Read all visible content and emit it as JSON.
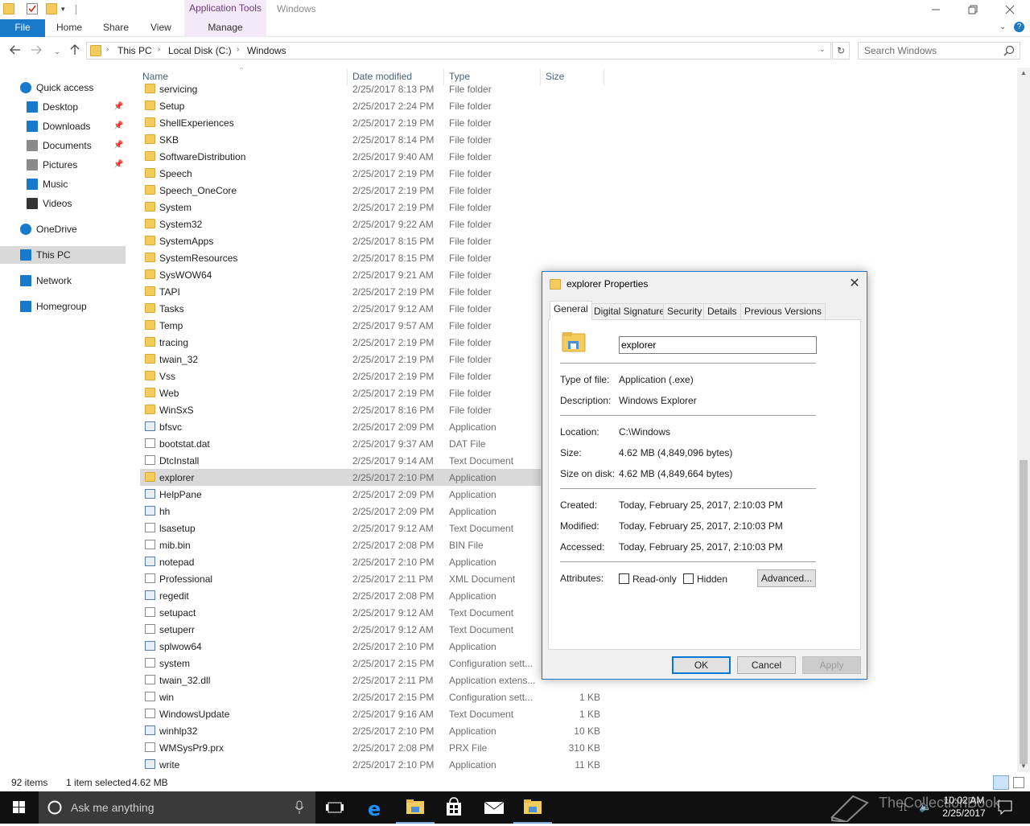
{
  "window": {
    "title": "Windows",
    "app_tools_label": "Application Tools",
    "manage_label": "Manage"
  },
  "ribbon": {
    "tabs": [
      "File",
      "Home",
      "Share",
      "View"
    ]
  },
  "address": {
    "crumbs": [
      "This PC",
      "Local Disk (C:)",
      "Windows"
    ],
    "search_placeholder": "Search Windows"
  },
  "nav": {
    "items": [
      {
        "label": "Quick access",
        "icon": "star-icon",
        "pinned": false
      },
      {
        "label": "Desktop",
        "icon": "desktop-icon",
        "pinned": true
      },
      {
        "label": "Downloads",
        "icon": "download-arrow-icon",
        "pinned": true
      },
      {
        "label": "Documents",
        "icon": "documents-icon",
        "pinned": true
      },
      {
        "label": "Pictures",
        "icon": "pictures-icon",
        "pinned": true
      },
      {
        "label": "Music",
        "icon": "music-note-icon",
        "pinned": false
      },
      {
        "label": "Videos",
        "icon": "film-icon",
        "pinned": false
      },
      {
        "label": "OneDrive",
        "icon": "cloud-icon",
        "pinned": false
      },
      {
        "label": "This PC",
        "icon": "computer-icon",
        "pinned": false,
        "selected": true
      },
      {
        "label": "Network",
        "icon": "network-icon",
        "pinned": false
      },
      {
        "label": "Homegroup",
        "icon": "homegroup-icon",
        "pinned": false
      }
    ]
  },
  "columns": {
    "name": "Name",
    "date": "Date modified",
    "type": "Type",
    "size": "Size"
  },
  "files": [
    {
      "name": "servicing",
      "date": "2/25/2017 8:13 PM",
      "type": "File folder",
      "size": "",
      "kind": "folder"
    },
    {
      "name": "Setup",
      "date": "2/25/2017 2:24 PM",
      "type": "File folder",
      "size": "",
      "kind": "folder"
    },
    {
      "name": "ShellExperiences",
      "date": "2/25/2017 2:19 PM",
      "type": "File folder",
      "size": "",
      "kind": "folder"
    },
    {
      "name": "SKB",
      "date": "2/25/2017 8:14 PM",
      "type": "File folder",
      "size": "",
      "kind": "folder"
    },
    {
      "name": "SoftwareDistribution",
      "date": "2/25/2017 9:40 AM",
      "type": "File folder",
      "size": "",
      "kind": "folder"
    },
    {
      "name": "Speech",
      "date": "2/25/2017 2:19 PM",
      "type": "File folder",
      "size": "",
      "kind": "folder"
    },
    {
      "name": "Speech_OneCore",
      "date": "2/25/2017 2:19 PM",
      "type": "File folder",
      "size": "",
      "kind": "folder"
    },
    {
      "name": "System",
      "date": "2/25/2017 2:19 PM",
      "type": "File folder",
      "size": "",
      "kind": "folder"
    },
    {
      "name": "System32",
      "date": "2/25/2017 9:22 AM",
      "type": "File folder",
      "size": "",
      "kind": "folder"
    },
    {
      "name": "SystemApps",
      "date": "2/25/2017 8:15 PM",
      "type": "File folder",
      "size": "",
      "kind": "folder"
    },
    {
      "name": "SystemResources",
      "date": "2/25/2017 8:15 PM",
      "type": "File folder",
      "size": "",
      "kind": "folder"
    },
    {
      "name": "SysWOW64",
      "date": "2/25/2017 9:21 AM",
      "type": "File folder",
      "size": "",
      "kind": "folder"
    },
    {
      "name": "TAPI",
      "date": "2/25/2017 2:19 PM",
      "type": "File folder",
      "size": "",
      "kind": "folder"
    },
    {
      "name": "Tasks",
      "date": "2/25/2017 9:12 AM",
      "type": "File folder",
      "size": "",
      "kind": "folder"
    },
    {
      "name": "Temp",
      "date": "2/25/2017 9:57 AM",
      "type": "File folder",
      "size": "",
      "kind": "folder"
    },
    {
      "name": "tracing",
      "date": "2/25/2017 2:19 PM",
      "type": "File folder",
      "size": "",
      "kind": "folder"
    },
    {
      "name": "twain_32",
      "date": "2/25/2017 2:19 PM",
      "type": "File folder",
      "size": "",
      "kind": "folder"
    },
    {
      "name": "Vss",
      "date": "2/25/2017 2:19 PM",
      "type": "File folder",
      "size": "",
      "kind": "folder"
    },
    {
      "name": "Web",
      "date": "2/25/2017 2:19 PM",
      "type": "File folder",
      "size": "",
      "kind": "folder"
    },
    {
      "name": "WinSxS",
      "date": "2/25/2017 8:16 PM",
      "type": "File folder",
      "size": "",
      "kind": "folder"
    },
    {
      "name": "bfsvc",
      "date": "2/25/2017 2:09 PM",
      "type": "Application",
      "size": "",
      "kind": "app"
    },
    {
      "name": "bootstat.dat",
      "date": "2/25/2017 9:37 AM",
      "type": "DAT File",
      "size": "",
      "kind": "doc"
    },
    {
      "name": "DtcInstall",
      "date": "2/25/2017 9:14 AM",
      "type": "Text Document",
      "size": "",
      "kind": "doc"
    },
    {
      "name": "explorer",
      "date": "2/25/2017 2:10 PM",
      "type": "Application",
      "size": "",
      "kind": "folder",
      "selected": true
    },
    {
      "name": "HelpPane",
      "date": "2/25/2017 2:09 PM",
      "type": "Application",
      "size": "",
      "kind": "app"
    },
    {
      "name": "hh",
      "date": "2/25/2017 2:09 PM",
      "type": "Application",
      "size": "",
      "kind": "app"
    },
    {
      "name": "lsasetup",
      "date": "2/25/2017 9:12 AM",
      "type": "Text Document",
      "size": "",
      "kind": "doc"
    },
    {
      "name": "mib.bin",
      "date": "2/25/2017 2:08 PM",
      "type": "BIN File",
      "size": "",
      "kind": "doc"
    },
    {
      "name": "notepad",
      "date": "2/25/2017 2:10 PM",
      "type": "Application",
      "size": "",
      "kind": "app"
    },
    {
      "name": "Professional",
      "date": "2/25/2017 2:11 PM",
      "type": "XML Document",
      "size": "",
      "kind": "doc"
    },
    {
      "name": "regedit",
      "date": "2/25/2017 2:08 PM",
      "type": "Application",
      "size": "",
      "kind": "app"
    },
    {
      "name": "setupact",
      "date": "2/25/2017 9:12 AM",
      "type": "Text Document",
      "size": "",
      "kind": "doc"
    },
    {
      "name": "setuperr",
      "date": "2/25/2017 9:12 AM",
      "type": "Text Document",
      "size": "",
      "kind": "doc"
    },
    {
      "name": "splwow64",
      "date": "2/25/2017 2:10 PM",
      "type": "Application",
      "size": "",
      "kind": "app"
    },
    {
      "name": "system",
      "date": "2/25/2017 2:15 PM",
      "type": "Configuration sett...",
      "size": "",
      "kind": "doc"
    },
    {
      "name": "twain_32.dll",
      "date": "2/25/2017 2:11 PM",
      "type": "Application extens...",
      "size": "",
      "kind": "doc"
    },
    {
      "name": "win",
      "date": "2/25/2017 2:15 PM",
      "type": "Configuration sett...",
      "size": "1 KB",
      "kind": "doc"
    },
    {
      "name": "WindowsUpdate",
      "date": "2/25/2017 9:16 AM",
      "type": "Text Document",
      "size": "1 KB",
      "kind": "doc"
    },
    {
      "name": "winhlp32",
      "date": "2/25/2017 2:10 PM",
      "type": "Application",
      "size": "10 KB",
      "kind": "app"
    },
    {
      "name": "WMSysPr9.prx",
      "date": "2/25/2017 2:08 PM",
      "type": "PRX File",
      "size": "310 KB",
      "kind": "doc"
    },
    {
      "name": "write",
      "date": "2/25/2017 2:10 PM",
      "type": "Application",
      "size": "11 KB",
      "kind": "app"
    }
  ],
  "status": {
    "items": "92 items",
    "selected": "1 item selected",
    "selected_size": "4.62 MB"
  },
  "dialog": {
    "title": "explorer Properties",
    "tabs": [
      "General",
      "Digital Signatures",
      "Security",
      "Details",
      "Previous Versions"
    ],
    "name_value": "explorer",
    "props": [
      {
        "label": "Type of file:",
        "value": "Application (.exe)"
      },
      {
        "label": "Description:",
        "value": "Windows Explorer"
      },
      {
        "label": "Location:",
        "value": "C:\\Windows"
      },
      {
        "label": "Size:",
        "value": "4.62 MB (4,849,096 bytes)"
      },
      {
        "label": "Size on disk:",
        "value": "4.62 MB (4,849,664 bytes)"
      },
      {
        "label": "Created:",
        "value": "Today, February 25, 2017, 2:10:03 PM"
      },
      {
        "label": "Modified:",
        "value": "Today, February 25, 2017, 2:10:03 PM"
      },
      {
        "label": "Accessed:",
        "value": "Today, February 25, 2017, 2:10:03 PM"
      }
    ],
    "attributes_label": "Attributes:",
    "readonly_label": "Read-only",
    "hidden_label": "Hidden",
    "advanced_label": "Advanced...",
    "ok_label": "OK",
    "cancel_label": "Cancel",
    "apply_label": "Apply"
  },
  "taskbar": {
    "search_placeholder": "Ask me anything",
    "time": "10:02 AM",
    "date": "2/25/2017",
    "watermark": "TheCollectionBook"
  },
  "colors": {
    "accent": "#1979ca",
    "selection": "#d9d9d9",
    "folder": "#f3cc5b",
    "taskbar": "#101010"
  }
}
